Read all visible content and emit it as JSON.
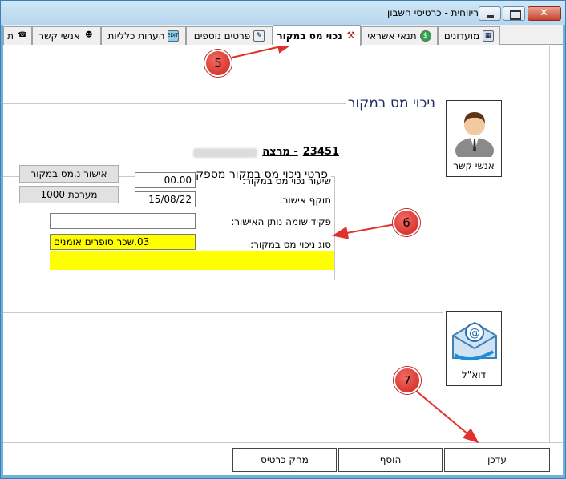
{
  "window": {
    "title": "ריווחית - כרטיסי חשבון",
    "frame_color": "#6fb2dc"
  },
  "tabs": [
    {
      "label": "מועדונים",
      "icon": "chart-icon"
    },
    {
      "label": "תנאי אשראי",
      "icon": "money-bag-icon"
    },
    {
      "label": "נכוי מס במקור",
      "icon": "tools-icon",
      "active": true
    },
    {
      "label": "פרטים נוספים",
      "icon": "document-icon"
    },
    {
      "label": "הערות כלליות",
      "icon": "edit-icon",
      "icon_text": "EDIT"
    },
    {
      "label": "אנשי קשר",
      "icon": "contacts-icon"
    },
    {
      "label": "ת",
      "icon": "phone-icon"
    }
  ],
  "section": {
    "title": "ניכוי מס במקור",
    "supplier_code": "23451",
    "supplier_suffix": "- מרצה"
  },
  "group": {
    "title": "פרטי ניכוי מס במקור מספק",
    "fields": {
      "rate_label": "שיעור נכוי מס במקור:",
      "rate_value": "00.00",
      "validity_label": "תוקף אישור:",
      "validity_value": "15/08/22",
      "officer_label": "פקיד שומה נותן האישור:",
      "officer_value": "",
      "type_label": "סוג ניכוי מס במקור:",
      "type_value": "03.שכר סופרים אומנים"
    },
    "buttons": {
      "approval": "אישור נ.מס במקור",
      "system": "מערכת 1000"
    }
  },
  "side": {
    "contacts_caption": "אנשי קשר",
    "email_caption": "דוא\"ל"
  },
  "bottom": {
    "update": "עדכן",
    "add": "הוסף",
    "delete": "מחק כרטיס"
  },
  "annotations": {
    "c5": "5",
    "c6": "6",
    "c7": "7",
    "color": "#e0312a"
  },
  "highlight_color": "#ffff00"
}
